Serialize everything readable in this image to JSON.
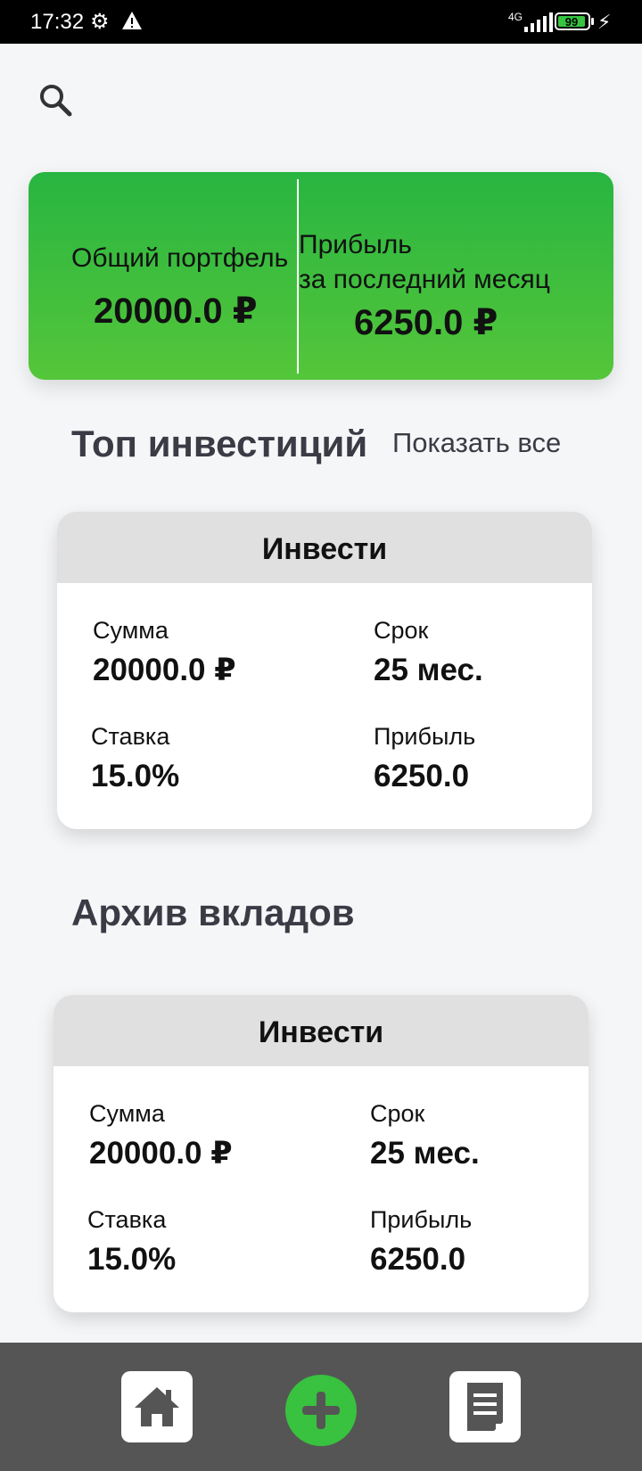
{
  "status_bar": {
    "time": "17:32",
    "network": "4G",
    "battery": "99"
  },
  "summary": {
    "portfolio_label": "Общий портфель",
    "portfolio_value": "20000.0 ₽",
    "profit_label_line1": "Прибыль",
    "profit_label_line2": "за последний месяц",
    "profit_value": "6250.0 ₽"
  },
  "top_section": {
    "title": "Топ инвестиций",
    "show_all": "Показать все"
  },
  "archive_section": {
    "title": "Архив вкладов"
  },
  "cards": [
    {
      "title": "Инвести",
      "sum_label": "Сумма",
      "sum_value": "20000.0 ₽",
      "term_label": "Срок",
      "term_value": "25 мес.",
      "rate_label": "Ставка",
      "rate_value": "15.0%",
      "profit_label": "Прибыль",
      "profit_value": "6250.0"
    },
    {
      "title": "Инвести",
      "sum_label": "Сумма",
      "sum_value": "20000.0 ₽",
      "term_label": "Срок",
      "term_value": "25 мес.",
      "rate_label": "Ставка",
      "rate_value": "15.0%",
      "profit_label": "Прибыль",
      "profit_value": "6250.0"
    }
  ],
  "colors": {
    "accent_green": "#38c23f",
    "nav_background": "#555555",
    "page_background": "#f5f6f8"
  },
  "icons": {
    "search": "search-icon",
    "home": "home-icon",
    "add": "plus-icon",
    "document": "document-icon"
  }
}
